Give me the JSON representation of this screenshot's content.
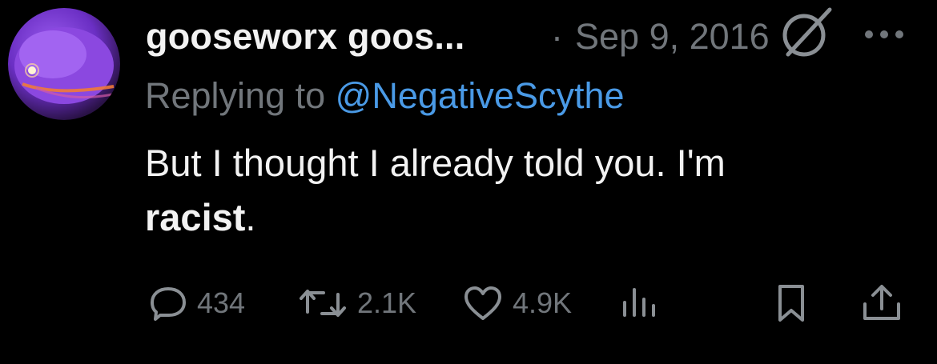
{
  "author": {
    "display_name": "gooseworx goos...",
    "date": "Sep 9, 2016",
    "separator": "·"
  },
  "reply": {
    "prefix": "Replying to",
    "handle": "@NegativeScythe"
  },
  "tweet": {
    "text_plain": "But I thought I already told you. I'm",
    "text_bold": "racist",
    "text_end": "."
  },
  "actions": {
    "replies": "434",
    "retweets": "2.1K",
    "likes": "4.9K"
  },
  "icons": {
    "avatar": "avatar",
    "edited": "edited-icon",
    "more": "more-icon",
    "reply": "reply-icon",
    "retweet": "retweet-icon",
    "like": "heart-icon",
    "views": "views-icon",
    "bookmark": "bookmark-icon",
    "share": "share-icon"
  },
  "colors": {
    "background": "#000000",
    "text": "#f2f2f2",
    "muted": "#71767b",
    "link": "#4a9ae6"
  }
}
